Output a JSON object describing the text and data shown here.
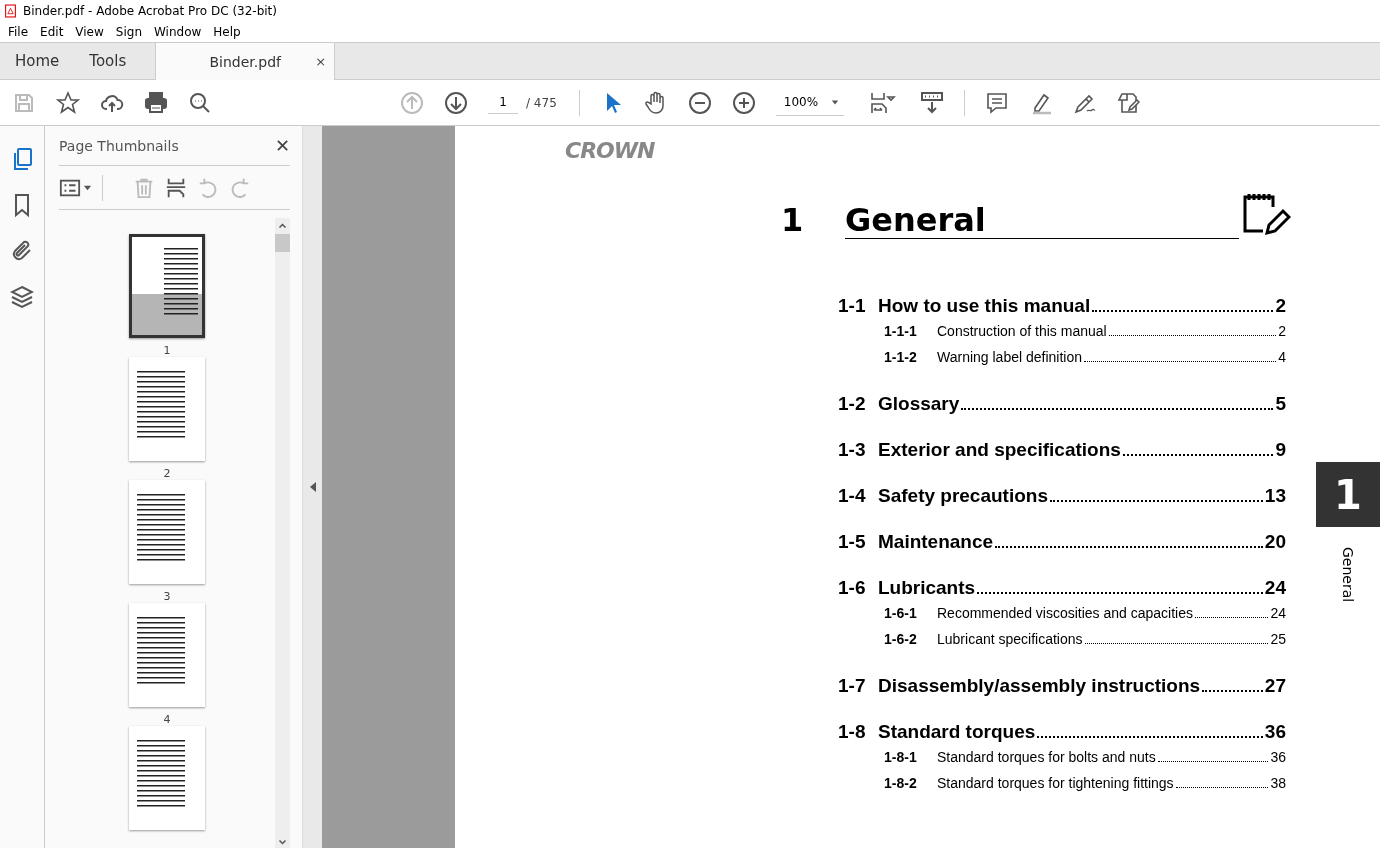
{
  "window": {
    "title": "Binder.pdf - Adobe Acrobat Pro DC (32-bit)"
  },
  "menu": [
    "File",
    "Edit",
    "View",
    "Sign",
    "Window",
    "Help"
  ],
  "tabs": [
    {
      "label": "Home",
      "selected": false,
      "kind": "nav"
    },
    {
      "label": "Tools",
      "selected": false,
      "kind": "nav"
    },
    {
      "label": "Binder.pdf",
      "selected": true,
      "kind": "document",
      "close": "×"
    }
  ],
  "toolbar": {
    "page_number": "1",
    "page_total": "/ 475",
    "zoom": "100%"
  },
  "rail": [
    {
      "kind": "pages",
      "selected": true
    },
    {
      "kind": "bookmark",
      "selected": false
    },
    {
      "kind": "clip",
      "selected": false
    },
    {
      "kind": "layers",
      "selected": false
    }
  ],
  "panel": {
    "title": "Page Thumbnails",
    "close": "✕",
    "thumbnails": [
      {
        "label": "1",
        "selected": true
      },
      {
        "label": "2",
        "selected": false
      },
      {
        "label": "3",
        "selected": false
      },
      {
        "label": "4",
        "selected": false
      },
      {
        "selected": false
      }
    ]
  },
  "document": {
    "logo": "CROWN",
    "chapter_number": "1",
    "chapter_title": "General",
    "side_tab_number": "1",
    "side_tab_label": "General",
    "toc": [
      {
        "number": "1-1",
        "title": "How to use this manual",
        "page": "2",
        "children": [
          {
            "number": "1-1-1",
            "title": "Construction of this manual",
            "page": "2"
          },
          {
            "number": "1-1-2",
            "title": "Warning label definition",
            "page": "4"
          }
        ]
      },
      {
        "number": "1-2",
        "title": "Glossary",
        "page": "5"
      },
      {
        "number": "1-3",
        "title": "Exterior and specifications",
        "page": "9"
      },
      {
        "number": "1-4",
        "title": "Safety precautions",
        "page": "13"
      },
      {
        "number": "1-5",
        "title": "Maintenance",
        "page": "20"
      },
      {
        "number": "1-6",
        "title": "Lubricants",
        "page": "24",
        "children": [
          {
            "number": "1-6-1",
            "title": "Recommended viscosities and capacities",
            "page": "24"
          },
          {
            "number": "1-6-2",
            "title": "Lubricant specifications",
            "page": "25"
          }
        ]
      },
      {
        "number": "1-7",
        "title": "Disassembly/assembly instructions",
        "page": "27"
      },
      {
        "number": "1-8",
        "title": "Standard torques",
        "page": "36",
        "children": [
          {
            "number": "1-8-1",
            "title": "Standard torques for bolts and nuts",
            "page": "36"
          },
          {
            "number": "1-8-2",
            "title": "Standard torques for tightening fittings",
            "page": "38"
          }
        ]
      }
    ]
  }
}
